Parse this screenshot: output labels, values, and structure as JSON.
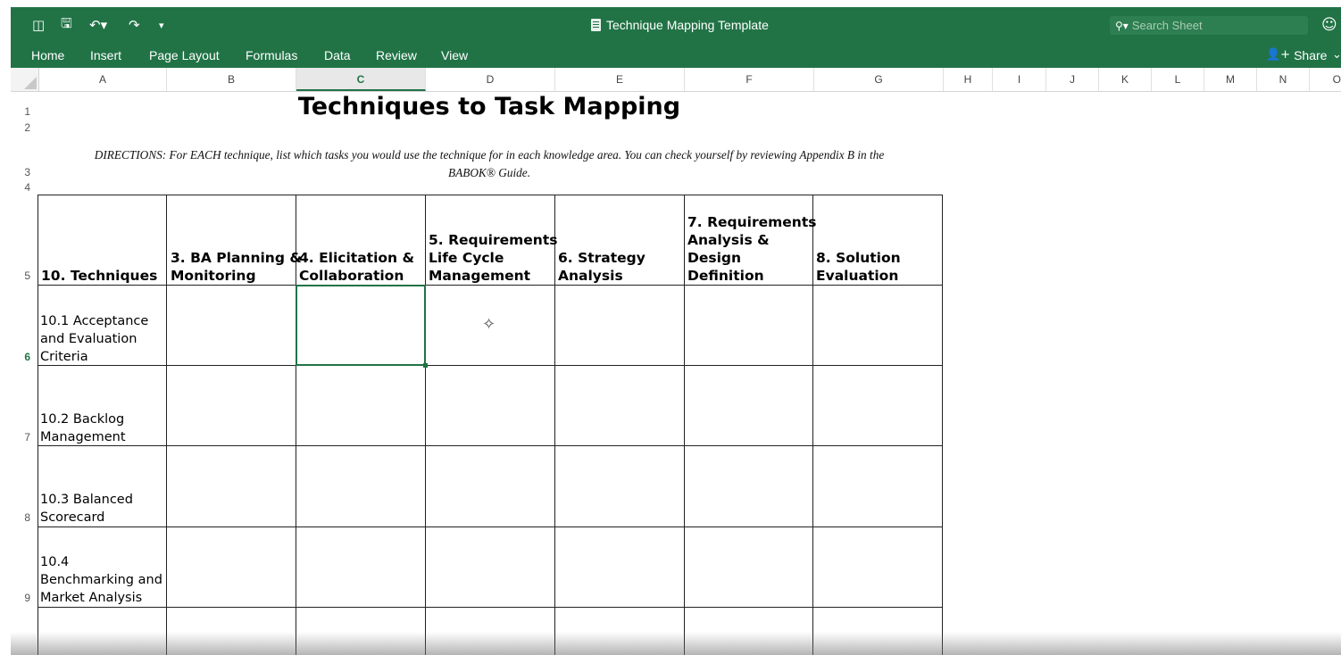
{
  "titlebar": {
    "document_title": "Technique Mapping Template",
    "search_placeholder": "Search Sheet",
    "icons": [
      "sidebar-toggle-icon",
      "save-icon",
      "undo-icon",
      "redo-icon",
      "customize-toolbar-icon",
      "document-icon",
      "search-icon",
      "smiley-feedback-icon"
    ]
  },
  "ribbon": {
    "tabs": [
      "Home",
      "Insert",
      "Page Layout",
      "Formulas",
      "Data",
      "Review",
      "View"
    ],
    "share_label": "Share"
  },
  "columns": [
    "A",
    "B",
    "C",
    "D",
    "E",
    "F",
    "G",
    "H",
    "I",
    "J",
    "K",
    "L",
    "M",
    "N",
    "O"
  ],
  "active_column": "C",
  "rows": [
    "1",
    "2",
    "3",
    "4",
    "5",
    "6",
    "7",
    "8",
    "9"
  ],
  "active_row": "6",
  "sheet": {
    "title": "Techniques to Task Mapping",
    "directions_line1": "DIRECTIONS: For EACH technique, list which tasks you would use the technique for in each knowledge area.  You can check yourself by reviewing Appendix B in the",
    "directions_line2": "BABOK® Guide.",
    "headers": [
      [
        "10. Techniques"
      ],
      [
        "3. BA Planning &",
        "Monitoring"
      ],
      [
        "4. Elicitation &",
        "Collaboration"
      ],
      [
        "5. Requirements",
        "Life Cycle",
        "Management"
      ],
      [
        "6. Strategy",
        "Analysis"
      ],
      [
        "7. Requirements",
        "Analysis &",
        "Design",
        "Definition"
      ],
      [
        "8. Solution",
        "Evaluation"
      ]
    ],
    "techniques": [
      [
        "10.1 Acceptance",
        "and Evaluation",
        "Criteria"
      ],
      [
        "10.2 Backlog",
        "Management"
      ],
      [
        "10.3 Balanced",
        "Scorecard"
      ],
      [
        "10.4",
        "Benchmarking and",
        "Market Analysis"
      ]
    ]
  },
  "colors": {
    "excel_green": "#217346",
    "grid_line": "#222222"
  }
}
